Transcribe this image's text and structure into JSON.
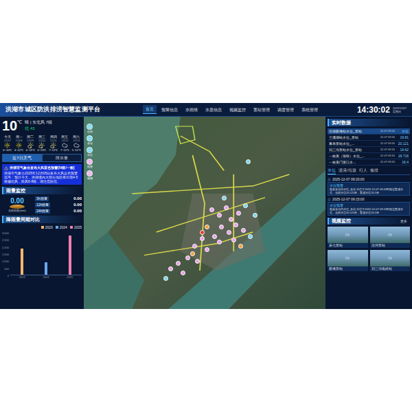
{
  "header": {
    "title": "洪湖市城区防洪排涝智慧监测平台",
    "nav": [
      {
        "label": "首页",
        "selected": true
      },
      {
        "label": "预警信息",
        "selected": false
      },
      {
        "label": "水雨情",
        "selected": false
      },
      {
        "label": "水质信息",
        "selected": false
      },
      {
        "label": "视频监控",
        "selected": false
      },
      {
        "label": "泵站管理",
        "selected": false
      },
      {
        "label": "调度管理",
        "selected": false
      },
      {
        "label": "系统管理",
        "selected": false
      }
    ],
    "time": "14:30:02",
    "date": "2025/12/07",
    "weekday": "星期日"
  },
  "weather": {
    "temp": "10",
    "unit": "℃",
    "desc": "晴 | 东北风 7级",
    "aqi": "优 43",
    "forecast": [
      {
        "day": "今天",
        "date": "12/07",
        "temp": "6~10℃",
        "weather": "sunny"
      },
      {
        "day": "周一",
        "date": "12/08",
        "temp": "4~12℃",
        "weather": "sunny"
      },
      {
        "day": "周二",
        "date": "12/09",
        "temp": "6~13℃",
        "weather": "partly"
      },
      {
        "day": "周三",
        "date": "12/10",
        "temp": "6~13℃",
        "weather": "partly"
      },
      {
        "day": "周四",
        "date": "12/11",
        "temp": "7~12℃",
        "weather": "partly"
      },
      {
        "day": "周五",
        "date": "12/12",
        "temp": "7~12℃",
        "weather": "cloudy"
      },
      {
        "day": "周六",
        "date": "12/13",
        "temp": "5~12℃",
        "weather": "cloudy"
      }
    ],
    "tabs": [
      {
        "label": "近7日天气",
        "selected": true
      },
      {
        "label": "降水量",
        "selected": false
      }
    ]
  },
  "alert": {
    "title": "洪湖市气象台发布大风蓝色预警[IV级/一般]",
    "body": "洪湖市气象台2025年12月05日发布大风蓝色预警信号：预计今天，洪湖境内大部分地区将出现4-5级偏北风，阵风6-8级，请注意防范。"
  },
  "rain": {
    "title": "雨量监控",
    "value": "0.00",
    "label": "当前雨量(mm)",
    "rows": [
      {
        "label": "3h雨量",
        "value": "0.00"
      },
      {
        "label": "12h雨量",
        "value": "0.00"
      },
      {
        "label": "24h雨量",
        "value": "0.00"
      }
    ]
  },
  "chart": {
    "title": "降雨量同期对比",
    "y_ticks": [
      "3,000",
      "2,500",
      "2,000",
      "1,500",
      "1,000",
      "500",
      "0"
    ],
    "x_labels": [
      "2023",
      "2024",
      "2025"
    ],
    "series": [
      {
        "name": "2023",
        "color": "#f5b56b",
        "values": [
          1800
        ]
      },
      {
        "name": "2024",
        "color": "#6aa7f0",
        "values": [
          850
        ]
      },
      {
        "name": "2025",
        "color": "#f07fb0",
        "values": [
          2650
        ]
      }
    ]
  },
  "map": {
    "layers": [
      {
        "label": "全部",
        "color": "#5fd0e8"
      },
      {
        "label": "泵站",
        "color": "#5fd0e8"
      },
      {
        "label": "水位",
        "color": "#5fd0e8"
      },
      {
        "label": "雨量",
        "color": "#e9a3e6"
      },
      {
        "label": "视频",
        "color": "#e9a3e6"
      }
    ],
    "pins": [
      {
        "color": "#e9a3e6"
      },
      {
        "color": "#e9a3e6"
      },
      {
        "color": "#e9a3e6"
      },
      {
        "color": "#e9a3e6"
      },
      {
        "color": "#e9a3e6"
      },
      {
        "color": "#e9a3e6"
      },
      {
        "color": "#e9a3e6"
      },
      {
        "color": "#e9a3e6"
      },
      {
        "color": "#e9a3e6"
      },
      {
        "color": "#e9a3e6"
      },
      {
        "color": "#e9a3e6"
      },
      {
        "color": "#e9a3e6"
      },
      {
        "color": "#e9a3e6"
      },
      {
        "color": "#e9a3e6"
      },
      {
        "color": "#e9a3e6"
      },
      {
        "color": "#e9a3e6"
      },
      {
        "color": "#e9a3e6"
      },
      {
        "color": "#e9a3e6"
      },
      {
        "color": "#e9a3e6"
      },
      {
        "color": "#e9a3e6"
      },
      {
        "color": "#7fd3e6"
      },
      {
        "color": "#7fd3e6"
      },
      {
        "color": "#7fd3e6"
      },
      {
        "color": "#7fd3e6"
      },
      {
        "color": "#7fd3e6"
      },
      {
        "color": "#f0a040"
      },
      {
        "color": "#f0a040"
      },
      {
        "color": "#f0a040"
      },
      {
        "color": "#e53935"
      },
      {
        "color": "#7fd3e6"
      }
    ]
  },
  "realtime": {
    "title": "实时数据",
    "rows": [
      {
        "name": "沿湖新滩站水位_泵站",
        "time": "12-07 09:20",
        "value": "水位",
        "selected": true
      },
      {
        "name": "兰溪湖站水位_泵站",
        "time": "12-07 09:20",
        "value": "19.81",
        "selected": false
      },
      {
        "name": "幕阜泵站水位_...",
        "time": "12-07 09:20",
        "value": "20.121",
        "selected": false
      },
      {
        "name": "刘三湾泵站水位_泵站",
        "time": "12-07 09:20",
        "value": "19.62",
        "selected": false
      },
      {
        "name": "一枝美（张咏）水位_...",
        "time": "12-07 09:20",
        "value": "18.718",
        "selected": false
      },
      {
        "name": "一枝美门家口水...",
        "time": "12-07 09:20",
        "value": "16.4",
        "selected": false
      }
    ]
  },
  "alerts": {
    "tabs": [
      {
        "label": "水位",
        "selected": true
      },
      {
        "label": "渍涝/垃圾",
        "selected": false
      },
      {
        "label": "行人",
        "selected": false
      },
      {
        "label": "偷排",
        "selected": false
      }
    ],
    "items": [
      {
        "time": "2025-12-07 09:20:00",
        "kind_label": "水位预警",
        "text": "蔬菜泵站内水位_泵站 水位于2025-12-07 09:20时超过警戒水位，当前水位20.121米，警戒水位20.1米"
      },
      {
        "time": "2025-12-07 09:15:00",
        "kind_label": "水位预警",
        "text": "蔬菜泵站内水位_泵站 水位于2025-12-07 09:15时超过警戒水位，当前水位20.121米，警戒水位20.1米"
      }
    ]
  },
  "video": {
    "title": "视频监控",
    "more": "更多",
    "cams": [
      {
        "label": "东七泵站"
      },
      {
        "label": "沿河泵站"
      },
      {
        "label": "新滩泵站"
      },
      {
        "label": "刘三湾电排站"
      }
    ]
  }
}
